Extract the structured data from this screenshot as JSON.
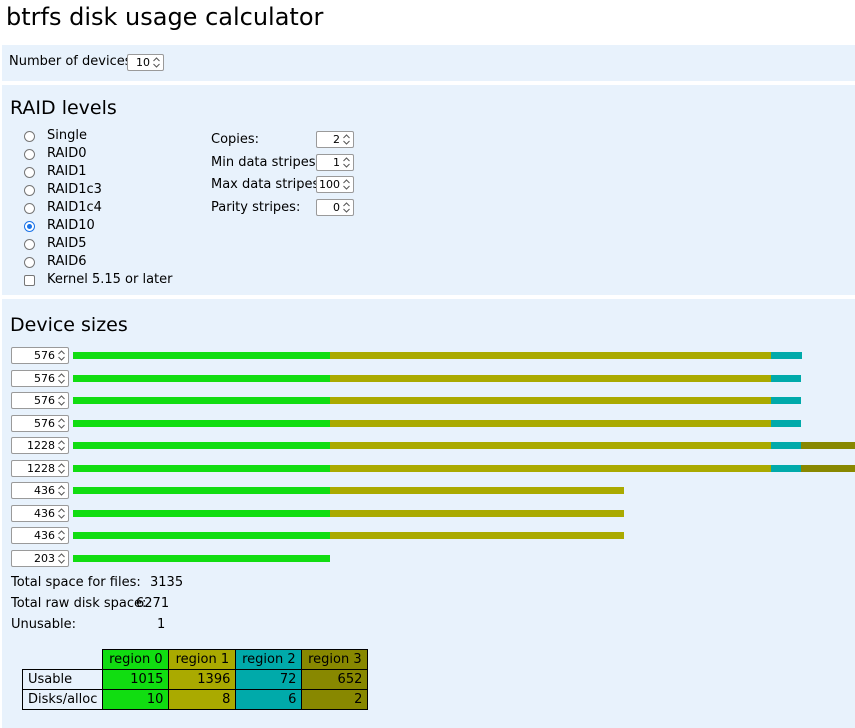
{
  "title": "btrfs disk usage calculator",
  "devices": {
    "label": "Number of devices:",
    "value": "10"
  },
  "raid": {
    "heading": "RAID levels",
    "options": [
      "Single",
      "RAID0",
      "RAID1",
      "RAID1c3",
      "RAID1c4",
      "RAID10",
      "RAID5",
      "RAID6"
    ],
    "selected": "RAID10",
    "kernel_label": "Kernel 5.15 or later",
    "kernel_checked": false,
    "params": [
      {
        "label": "Copies:",
        "value": "2"
      },
      {
        "label": "Min data stripes:",
        "value": "1"
      },
      {
        "label": "Max data stripes:",
        "value": "100"
      },
      {
        "label": "Parity stripes:",
        "value": "0"
      }
    ]
  },
  "sizes": {
    "heading": "Device sizes",
    "devices": [
      {
        "size": "576",
        "regions": [
          257,
          441,
          31,
          0
        ]
      },
      {
        "size": "576",
        "regions": [
          257,
          441,
          30,
          0
        ]
      },
      {
        "size": "576",
        "regions": [
          257,
          441,
          30,
          0
        ]
      },
      {
        "size": "576",
        "regions": [
          257,
          441,
          30,
          0
        ]
      },
      {
        "size": "1228",
        "regions": [
          257,
          441,
          30,
          54
        ]
      },
      {
        "size": "1228",
        "regions": [
          257,
          441,
          30,
          54
        ]
      },
      {
        "size": "436",
        "regions": [
          257,
          294,
          0,
          0
        ]
      },
      {
        "size": "436",
        "regions": [
          257,
          294,
          0,
          0
        ]
      },
      {
        "size": "436",
        "regions": [
          257,
          294,
          0,
          0
        ]
      },
      {
        "size": "203",
        "regions": [
          257,
          0,
          0,
          0
        ]
      }
    ],
    "region_colors": [
      "#11dd11",
      "#aaaa00",
      "#00aaaa",
      "#888800"
    ]
  },
  "summary": [
    {
      "label": "Total space for files:",
      "value": "3135"
    },
    {
      "label": "Total raw disk space:",
      "value": "6271"
    },
    {
      "label": "Unusable:",
      "value": "1"
    }
  ],
  "table": {
    "headers": [
      "region 0",
      "region 1",
      "region 2",
      "region 3"
    ],
    "rows": [
      {
        "label": "Usable",
        "values": [
          "1015",
          "1396",
          "72",
          "652"
        ]
      },
      {
        "label": "Disks/alloc",
        "values": [
          "10",
          "8",
          "6",
          "2"
        ]
      }
    ]
  }
}
